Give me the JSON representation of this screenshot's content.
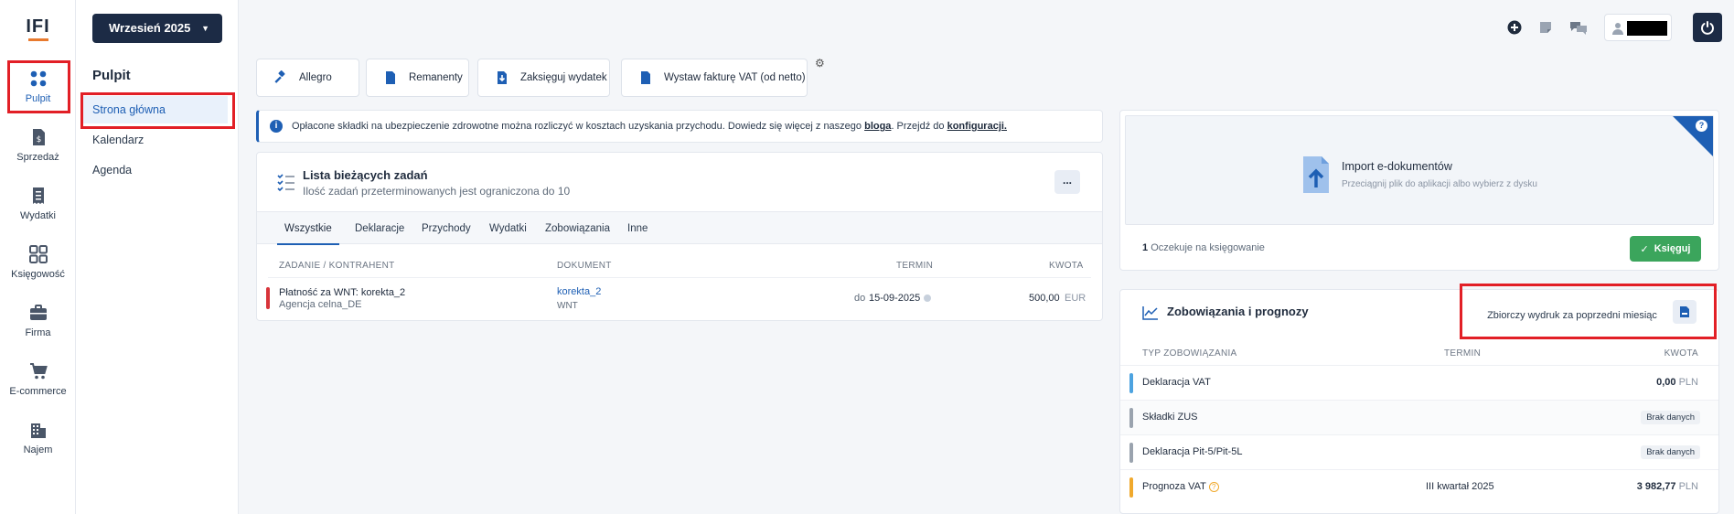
{
  "app": {
    "logo": "IFI"
  },
  "rail": [
    {
      "label": "Pulpit",
      "icon": "dashboard-icon",
      "active": true
    },
    {
      "label": "Sprzedaż",
      "icon": "invoice-icon"
    },
    {
      "label": "Wydatki",
      "icon": "receipt-icon"
    },
    {
      "label": "Księgowość",
      "icon": "accounting-icon"
    },
    {
      "label": "Firma",
      "icon": "briefcase-icon"
    },
    {
      "label": "E-commerce",
      "icon": "cart-icon"
    },
    {
      "label": "Najem",
      "icon": "building-icon"
    }
  ],
  "submenu": {
    "month": "Wrzesień 2025",
    "title": "Pulpit",
    "items": [
      "Strona główna",
      "Kalendarz",
      "Agenda"
    ]
  },
  "toolbar": [
    "Allegro",
    "Remanenty",
    "Zaksięguj wydatek",
    "Wystaw fakturę VAT (od netto)"
  ],
  "info": {
    "text": "Opłacone składki na ubezpieczenie zdrowotne można rozliczyć w kosztach uzyskania przychodu. Dowiedz się więcej z naszego",
    "link1": "bloga",
    "middle": ". Przejdź do",
    "link2": "konfiguracji."
  },
  "tasks": {
    "title": "Lista bieżących zadań",
    "subtitle": "Ilość zadań przeterminowanych jest ograniczona do 10",
    "more": "...",
    "tabs": [
      "Wszystkie",
      "Deklaracje",
      "Przychody",
      "Wydatki",
      "Zobowiązania",
      "Inne"
    ],
    "headers": {
      "task": "ZADANIE / KONTRAHENT",
      "doc": "DOKUMENT",
      "term": "TERMIN",
      "amount": "KWOTA"
    },
    "rows": [
      {
        "task": "Płatność za WNT: korekta_2",
        "contractor": "Agencja celna_DE",
        "doc": "korekta_2",
        "doc_type": "WNT",
        "term_prefix": "do",
        "term": "15-09-2025",
        "amount": "500,00",
        "currency": "EUR"
      }
    ]
  },
  "import": {
    "title": "Import e-dokumentów",
    "subtitle": "Przeciągnij plik do aplikacji albo wybierz z dysku",
    "help": "?",
    "pending_count": "1",
    "pending_text": "Oczekuje na księgowanie",
    "book_button": "Księguj"
  },
  "zob": {
    "title": "Zobowiązania i prognozy",
    "print_button": "Zbiorczy wydruk za poprzedni miesiąc",
    "headers": {
      "type": "TYP ZOBOWIĄZANIA",
      "term": "TERMIN",
      "amount": "KWOTA"
    },
    "rows": [
      {
        "name": "Deklaracja VAT",
        "term": "",
        "amount": "0,00",
        "currency": "PLN",
        "badge": "",
        "color": "#4da3e0"
      },
      {
        "name": "Składki ZUS",
        "term": "",
        "amount": "",
        "currency": "",
        "badge": "Brak danych",
        "color": "#9aa3ae"
      },
      {
        "name": "Deklaracja Pit-5/Pit-5L",
        "term": "",
        "amount": "",
        "currency": "",
        "badge": "Brak danych",
        "color": "#9aa3ae"
      },
      {
        "name": "Prognoza VAT",
        "term": "III kwartał 2025",
        "amount": "3 982,77",
        "currency": "PLN",
        "badge": "",
        "color": "#f0a92d"
      }
    ]
  },
  "colors": {
    "accent": "#1e5fb4",
    "dark": "#1c2b45",
    "success": "#3ba55c",
    "danger": "#d8343a",
    "highlight": "#e21f26"
  }
}
